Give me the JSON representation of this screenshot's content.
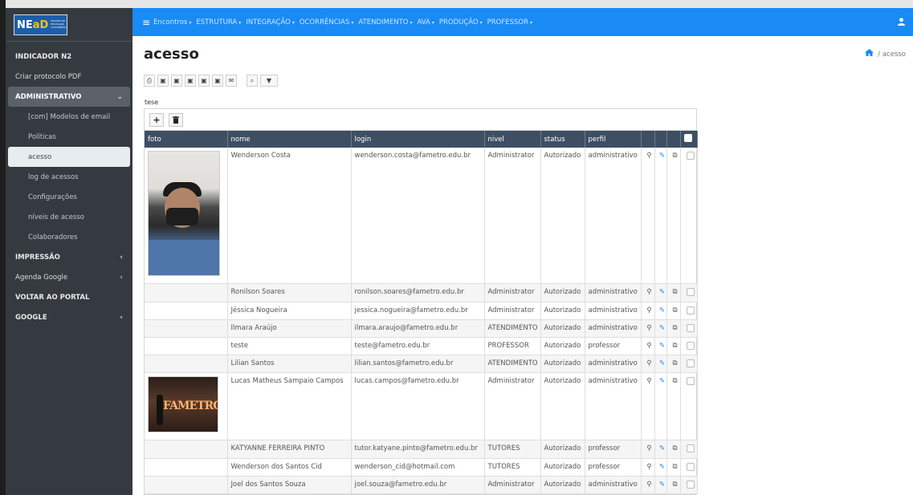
{
  "brand": {
    "logo_text_ne": "NE",
    "logo_text_ad": "aD",
    "logo_sub": "NÚCLEO DE EDUCAÇÃO A DISTÂNCIA",
    "logo_strip": "CENTRO UNIVERSITÁRIO"
  },
  "sidebar": {
    "items": [
      {
        "label": "INDICADOR N2",
        "style": "bold"
      },
      {
        "label": "Criar protocolo PDF",
        "style": "normal"
      },
      {
        "label": "ADMINISTRATIVO",
        "style": "open",
        "chevron": "⌄"
      },
      {
        "label": "[com] Modelos de email",
        "style": "sub"
      },
      {
        "label": "Políticas",
        "style": "sub"
      },
      {
        "label": "acesso",
        "style": "active"
      },
      {
        "label": "log de acessos",
        "style": "sub"
      },
      {
        "label": "Configurações",
        "style": "sub"
      },
      {
        "label": "níveis de acesso",
        "style": "sub"
      },
      {
        "label": "Colaboradores",
        "style": "sub"
      },
      {
        "label": "IMPRESSÃO",
        "style": "bold",
        "chevron": "‹"
      },
      {
        "label": "Agenda Google",
        "style": "normal",
        "chevron": "‹"
      },
      {
        "label": "VOLTAR AO PORTAL",
        "style": "bold"
      },
      {
        "label": "GOOGLE",
        "style": "bold",
        "chevron": "‹"
      }
    ]
  },
  "topnav": {
    "menu_icon": "≡",
    "items": [
      "Encontros",
      "ESTRUTURA",
      "INTEGRAÇÃO",
      "OCORRÊNCIAS",
      "ATENDIMENTO",
      "AVA",
      "PRODUÇÃO",
      "PROFESSOR"
    ],
    "caret": "▾",
    "user_icon": "user-icon"
  },
  "page": {
    "title": "acesso",
    "breadcrumb_current": "acesso",
    "breadcrumb_sep": "/",
    "table_caption": "tese"
  },
  "toolbar": {
    "buttons": [
      {
        "name": "print-icon",
        "glyph": "⎙"
      },
      {
        "name": "export-xls-icon",
        "glyph": "▣"
      },
      {
        "name": "export-doc-icon",
        "glyph": "▣"
      },
      {
        "name": "export-pdf-icon",
        "glyph": "▣"
      },
      {
        "name": "export-csv-icon",
        "glyph": "▣"
      },
      {
        "name": "export-xml-icon",
        "glyph": "▣"
      },
      {
        "name": "email-icon",
        "glyph": "✉"
      }
    ],
    "search_glyph": "⌕",
    "filter_glyph": "▼"
  },
  "grid": {
    "add_glyph": "+",
    "delete_glyph": "🗑",
    "columns": [
      "foto",
      "nome",
      "login",
      "nivel",
      "status",
      "perfil"
    ],
    "action_glyphs": {
      "view": "⚲",
      "edit": "✎",
      "copy": "⧉"
    },
    "rows": [
      {
        "photo": "photo-person-mask",
        "nome": "Wenderson Costa",
        "login": "wenderson.costa@fametro.edu.br",
        "nivel": "Administrator",
        "status": "Autorizado",
        "perfil": "administrativo"
      },
      {
        "photo": "",
        "nome": "Ronilson Soares",
        "login": "ronilson.soares@fametro.edu.br",
        "nivel": "Administrator",
        "status": "Autorizado",
        "perfil": "administrativo"
      },
      {
        "photo": "",
        "nome": "Jéssica Nogueira",
        "login": "jessica.nogueira@fametro.edu.br",
        "nivel": "Administrator",
        "status": "Autorizado",
        "perfil": "administrativo"
      },
      {
        "photo": "",
        "nome": "Ilmara Araújo",
        "login": "ilmara.araujo@fametro.edu.br",
        "nivel": "ATENDIMENTO",
        "status": "Autorizado",
        "perfil": "administrativo"
      },
      {
        "photo": "",
        "nome": "teste",
        "login": "teste@fametro.edu.br",
        "nivel": "PROFESSOR",
        "status": "Autorizado",
        "perfil": "professor"
      },
      {
        "photo": "",
        "nome": "Lilian Santos",
        "login": "lilian.santos@fametro.edu.br",
        "nivel": "ATENDIMENTO",
        "status": "Autorizado",
        "perfil": "administrativo"
      },
      {
        "photo": "photo-fametro-sign",
        "nome": "Lucas Matheus Sampaio Campos",
        "login": "lucas.campos@fametro.edu.br",
        "nivel": "Administrator",
        "status": "Autorizado",
        "perfil": "administrativo"
      },
      {
        "photo": "",
        "nome": "KATYANNE FERREIRA PINTO",
        "login": "tutor.katyane.pinto@fametro.edu.br",
        "nivel": "TUTORES",
        "status": "Autorizado",
        "perfil": "professor"
      },
      {
        "photo": "",
        "nome": "Wenderson dos Santos Cid",
        "login": "wenderson_cid@hotmail.com",
        "nivel": "TUTORES",
        "status": "Autorizado",
        "perfil": "professor"
      },
      {
        "photo": "",
        "nome": "Joel dos Santos Souza",
        "login": "joel.souza@fametro.edu.br",
        "nivel": "Administrator",
        "status": "Autorizado",
        "perfil": "administrativo"
      }
    ],
    "photo2_sign": "FAMETRO"
  },
  "colors": {
    "topbar": "#1a8bf5",
    "sidebar": "#343a40",
    "table_header": "#3e4f63"
  }
}
